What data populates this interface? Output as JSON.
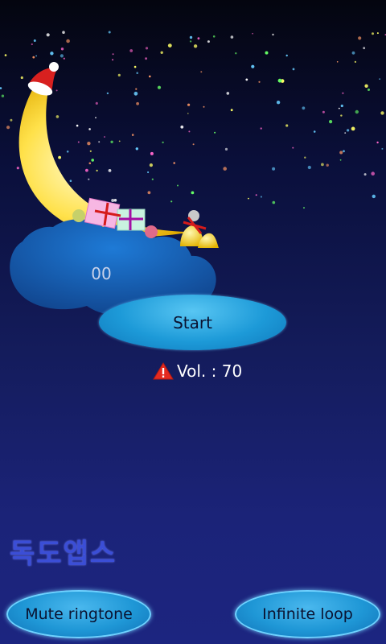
{
  "main": {
    "counter": "00",
    "start_label": "Start",
    "volume_text": "Vol. : 70"
  },
  "brand": {
    "text": "독도앱스"
  },
  "buttons": {
    "mute_label": "Mute ringtone",
    "loop_label": "Infinite loop"
  },
  "icons": {
    "warning": "warning-icon",
    "moon": "crescent-moon-icon",
    "santa_hat": "santa-hat-icon",
    "bells": "bells-icon",
    "gift": "gift-box-icon",
    "cloud": "cloud-icon"
  },
  "colors": {
    "button_blue": "#1d9ad8",
    "moon_yellow": "#ffe14a",
    "cloud_blue": "#1a5fb0",
    "brand_text": "#3b4ed6"
  }
}
